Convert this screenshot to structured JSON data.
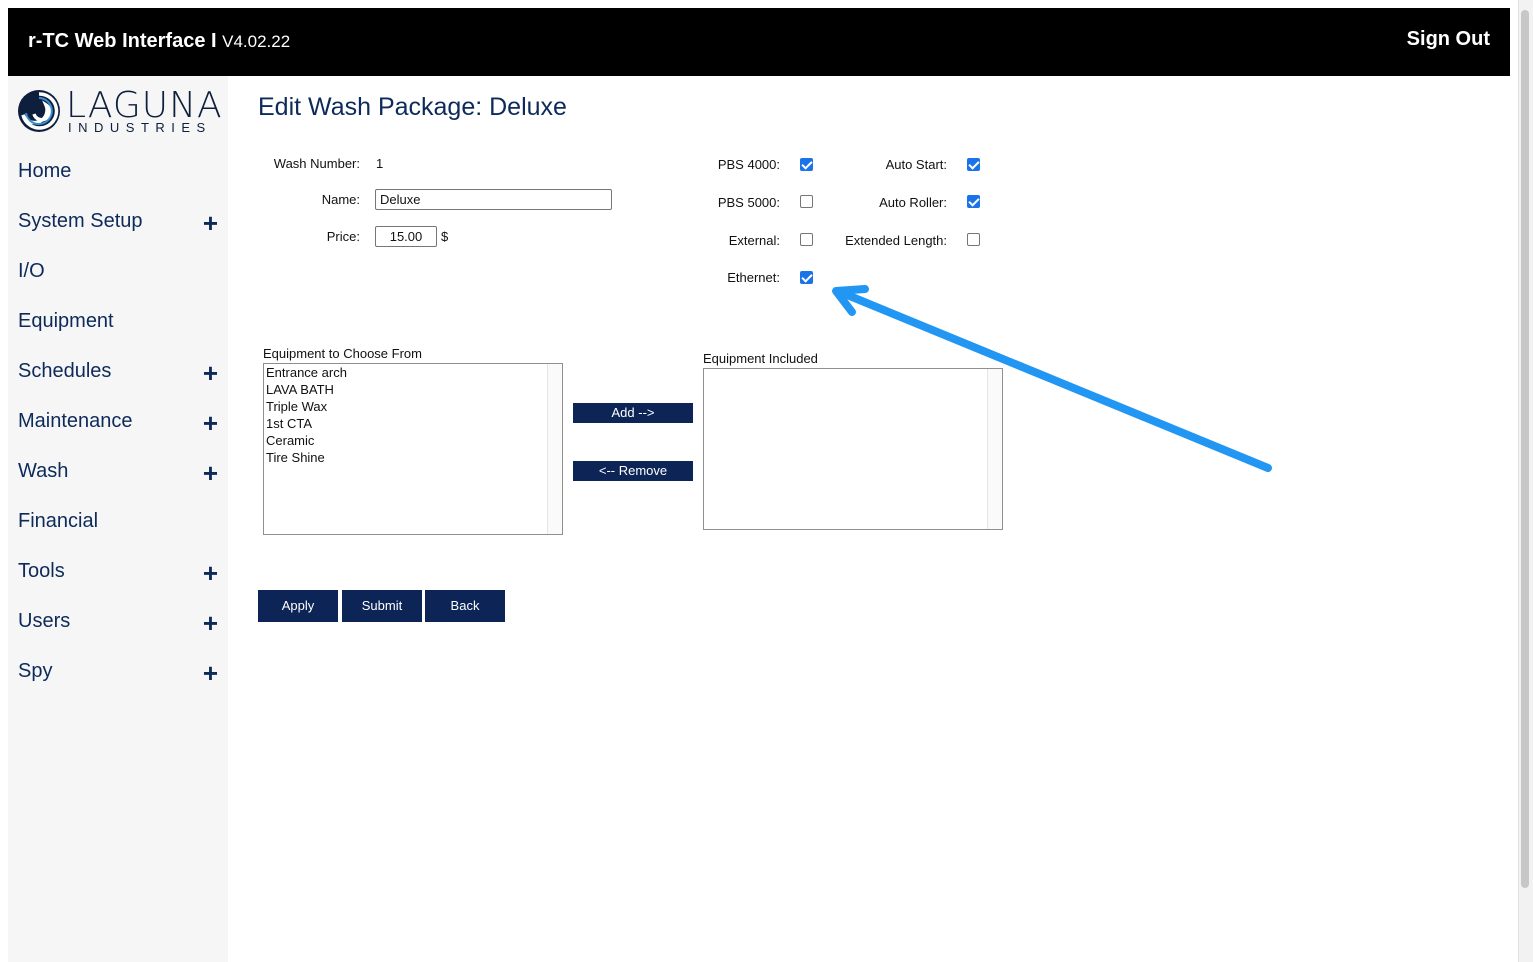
{
  "header": {
    "app_title": "r-TC Web Interface I",
    "version": "V4.02.22",
    "sign_out": "Sign Out"
  },
  "logo": {
    "brand": "LAGUNA",
    "sub": "INDUSTRIES"
  },
  "sidebar": {
    "items": [
      {
        "label": "Home",
        "expandable": false
      },
      {
        "label": "System Setup",
        "expandable": true
      },
      {
        "label": "I/O",
        "expandable": false
      },
      {
        "label": "Equipment",
        "expandable": false
      },
      {
        "label": "Schedules",
        "expandable": true
      },
      {
        "label": "Maintenance",
        "expandable": true
      },
      {
        "label": "Wash",
        "expandable": true
      },
      {
        "label": "Financial",
        "expandable": false
      },
      {
        "label": "Tools",
        "expandable": true
      },
      {
        "label": "Users",
        "expandable": true
      },
      {
        "label": "Spy",
        "expandable": true
      }
    ],
    "plus_glyph": "+"
  },
  "page": {
    "title": "Edit Wash Package: Deluxe"
  },
  "form": {
    "wash_number_label": "Wash Number:",
    "wash_number_value": "1",
    "name_label": "Name:",
    "name_value": "Deluxe",
    "price_label": "Price:",
    "price_value": "15.00",
    "price_unit": "$"
  },
  "options": {
    "pbs4000": {
      "label": "PBS 4000:",
      "checked": true
    },
    "pbs5000": {
      "label": "PBS 5000:",
      "checked": false
    },
    "external": {
      "label": "External:",
      "checked": false
    },
    "ethernet": {
      "label": "Ethernet:",
      "checked": true
    },
    "auto_start": {
      "label": "Auto Start:",
      "checked": true
    },
    "auto_roller": {
      "label": "Auto Roller:",
      "checked": true
    },
    "extended_length": {
      "label": "Extended Length:",
      "checked": false
    }
  },
  "equipment": {
    "available_caption": "Equipment to Choose From",
    "available": [
      "Entrance arch",
      "LAVA BATH",
      "Triple Wax",
      "1st CTA",
      "Ceramic",
      "Tire Shine"
    ],
    "included_caption": "Equipment Included",
    "included": [],
    "add_label": "Add -->",
    "remove_label": "<-- Remove"
  },
  "actions": {
    "apply": "Apply",
    "submit": "Submit",
    "back": "Back"
  },
  "annotation": {
    "arrow_color": "#2196f3"
  }
}
